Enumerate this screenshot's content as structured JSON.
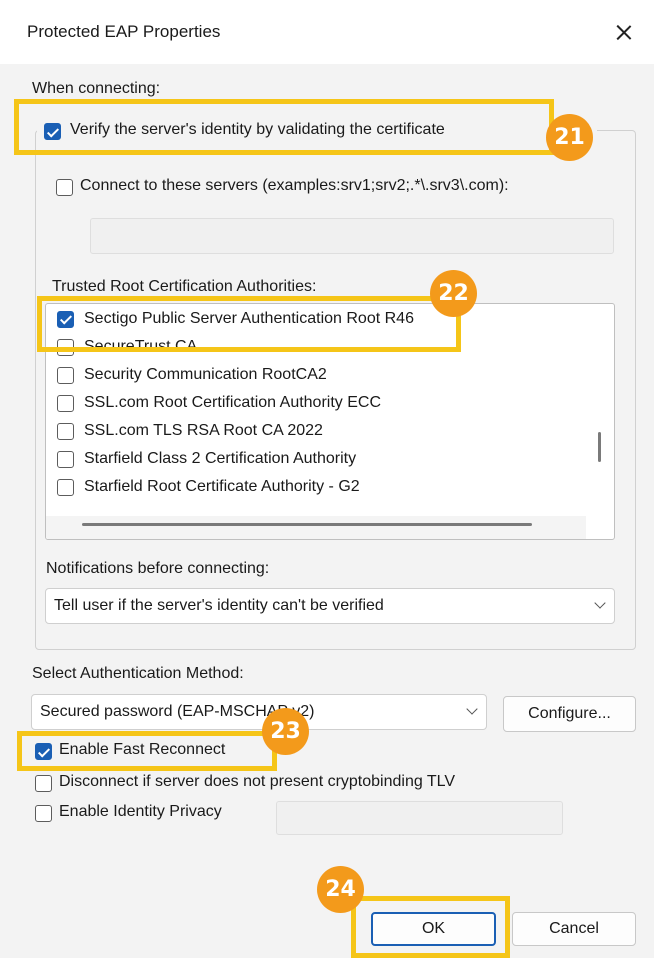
{
  "window": {
    "title": "Protected EAP Properties"
  },
  "when_connecting": {
    "heading": "When connecting:",
    "verify_label": "Verify the server's identity by validating the certificate",
    "verify_checked": true,
    "connect_servers_label": "Connect to these servers (examples:srv1;srv2;.*\\.srv3\\.com):",
    "connect_servers_checked": false,
    "servers_value": ""
  },
  "trusted_root": {
    "heading": "Trusted Root Certification Authorities:",
    "items": [
      {
        "label": "Sectigo Public Server Authentication Root R46",
        "checked": true
      },
      {
        "label": "SecureTrust CA",
        "checked": false
      },
      {
        "label": "Security Communication RootCA2",
        "checked": false
      },
      {
        "label": "SSL.com Root Certification Authority ECC",
        "checked": false
      },
      {
        "label": "SSL.com TLS RSA Root CA 2022",
        "checked": false
      },
      {
        "label": "Starfield Class 2 Certification Authority",
        "checked": false
      },
      {
        "label": "Starfield Root Certificate Authority - G2",
        "checked": false
      }
    ]
  },
  "notifications": {
    "heading": "Notifications before connecting:",
    "selected": "Tell user if the server's identity can't be verified"
  },
  "auth_method": {
    "heading": "Select Authentication Method:",
    "selected": "Secured password (EAP-MSCHAP v2)",
    "configure_label": "Configure..."
  },
  "options": {
    "fast_reconnect_label": "Enable Fast Reconnect",
    "fast_reconnect_checked": true,
    "cryptobinding_label": "Disconnect if server does not present cryptobinding TLV",
    "cryptobinding_checked": false,
    "identity_privacy_label": "Enable Identity Privacy",
    "identity_privacy_checked": false,
    "identity_privacy_value": ""
  },
  "buttons": {
    "ok_label": "OK",
    "cancel_label": "Cancel"
  },
  "callouts": [
    "21",
    "22",
    "23",
    "24"
  ],
  "colors": {
    "highlight": "#f5c518",
    "badge": "#f39a1b",
    "accent": "#1a5fb4"
  }
}
